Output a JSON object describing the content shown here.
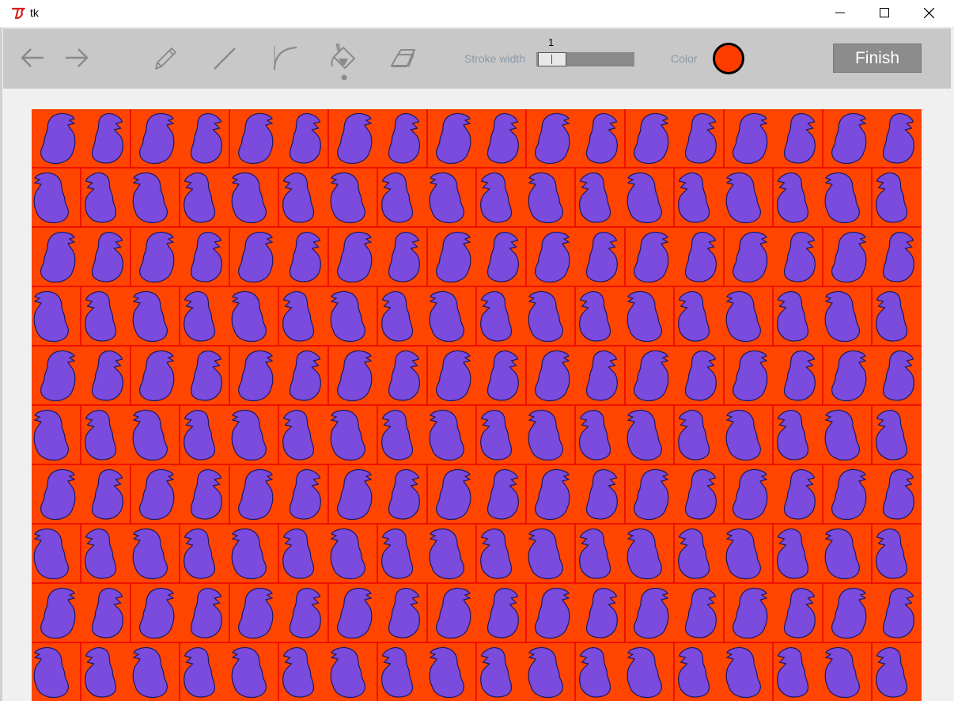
{
  "window": {
    "title": "tk"
  },
  "toolbar": {
    "tools": [
      {
        "name": "undo-arrow-icon"
      },
      {
        "name": "redo-arrow-icon"
      },
      {
        "name": "pencil-icon"
      },
      {
        "name": "line-icon"
      },
      {
        "name": "curve-icon"
      },
      {
        "name": "fill-bucket-icon"
      },
      {
        "name": "eraser-icon"
      }
    ],
    "stroke_width_label": "Stroke width",
    "stroke_width_value": "1",
    "color_label": "Color",
    "finish_label": "Finish"
  },
  "colors": {
    "toolbar_bg": "#c8c8c8",
    "selected_color": "#ff3c00",
    "tile_bg": "#ff4500",
    "tile_border": "#e80000",
    "shape_fill": "#7a4bdc",
    "shape_outline": "#1a1a66",
    "tool_icon": "#8a8a8a"
  },
  "canvas": {
    "pattern": "tiled-purple-blob-on-orange",
    "rows": 10
  }
}
